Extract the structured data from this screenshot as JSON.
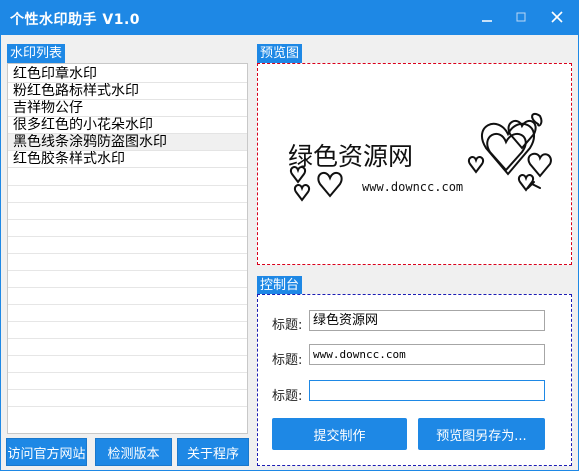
{
  "window": {
    "title": "个性水印助手 V1.0"
  },
  "watermark_list": {
    "header": "水印列表",
    "items": [
      "红色印章水印",
      "粉红色路标样式水印",
      "吉祥物公仔",
      "很多红色的小花朵水印",
      "黑色线条涂鸦防盗图水印",
      "红色胶条样式水印"
    ],
    "selected_index": 4
  },
  "preview": {
    "header": "预览图",
    "watermark_title": "绿色资源网",
    "watermark_url": "www.downcc.com"
  },
  "control": {
    "header": "控制台",
    "fields": [
      {
        "label": "标题:",
        "value": "绿色资源网"
      },
      {
        "label": "标题:",
        "value": "www.downcc.com"
      },
      {
        "label": "标题:",
        "value": ""
      }
    ],
    "submit_label": "提交制作",
    "save_label": "预览图另存为..."
  },
  "footer": {
    "visit_site": "访问官方网站",
    "check_version": "检测版本",
    "about": "关于程序"
  },
  "colors": {
    "accent": "#1e88e5",
    "preview_border": "#d9001b",
    "control_border": "#1c1cb4"
  }
}
